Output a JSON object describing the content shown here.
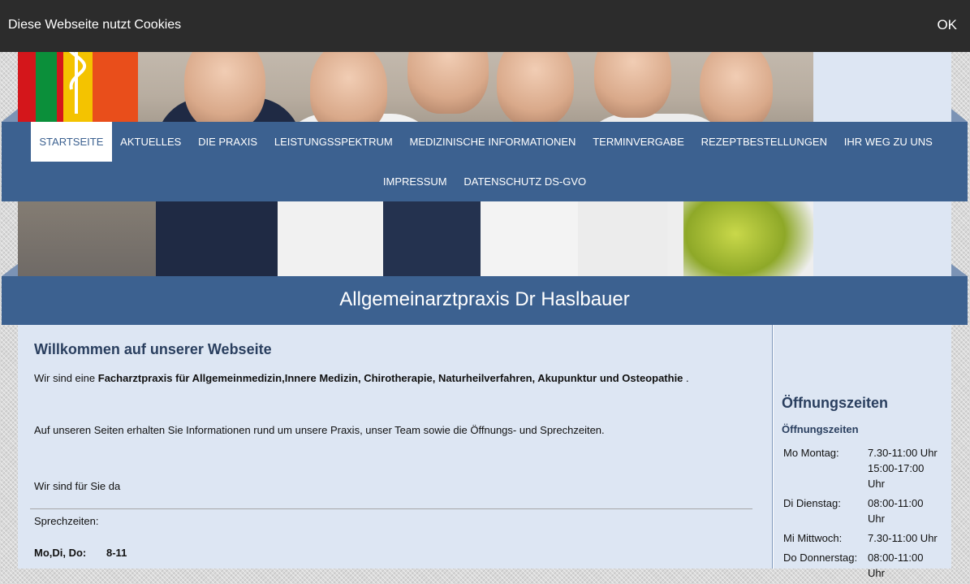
{
  "cookie_bar": {
    "text": "Diese Webseite nutzt Cookies",
    "ok_label": "OK"
  },
  "nav": {
    "items": [
      {
        "label": "STARTSEITE",
        "active": true
      },
      {
        "label": "AKTUELLES"
      },
      {
        "label": "DIE PRAXIS"
      },
      {
        "label": "LEISTUNGSSPEKTRUM"
      },
      {
        "label": "MEDIZINISCHE INFORMATIONEN"
      },
      {
        "label": "TERMINVERGABE"
      },
      {
        "label": "REZEPTBESTELLUNGEN"
      },
      {
        "label": "IHR WEG ZU UNS"
      },
      {
        "label": "IMPRESSUM"
      },
      {
        "label": "DATENSCHUTZ DS-GVO"
      }
    ]
  },
  "site_title": "Allgemeinarztpraxis Dr Haslbauer",
  "main": {
    "heading": "Willkommen auf unserer Webseite",
    "intro_prefix": "Wir sind eine ",
    "intro_bold": "Facharztpraxis für Allgemeinmedizin,Innere Medizin, Chirotherapie, Naturheilverfahren, Akupunktur und Osteopathie",
    "intro_suffix": " .",
    "info": "Auf unseren Seiten erhalten Sie Informationen rund um unsere Praxis, unser Team sowie die Öffnungs- und Sprechzeiten.",
    "there_for_you": "Wir sind für Sie da",
    "consult_label": "Sprechzeiten:",
    "consult_days": "Mo,Di, Do:",
    "consult_hours": "8-11"
  },
  "sidebar": {
    "heading": "Öffnungszeiten",
    "subheading": "Öffnungszeiten",
    "hours": [
      {
        "day": "Mo  Montag:",
        "time": "7.30-11:00 Uhr 15:00-17:00 Uhr"
      },
      {
        "day": "Di  Dienstag:",
        "time": "08:00-11:00 Uhr"
      },
      {
        "day": "Mi  Mittwoch:",
        "time": "7.30-11:00 Uhr"
      },
      {
        "day": "Do  Donnerstag:",
        "time": "08:00-11:00 Uhr"
      }
    ]
  },
  "colors": {
    "nav_bg": "#3c6190",
    "content_bg": "#dde6f3",
    "heading": "#2a3f5f",
    "cookie_bg": "#2c2c2c"
  }
}
